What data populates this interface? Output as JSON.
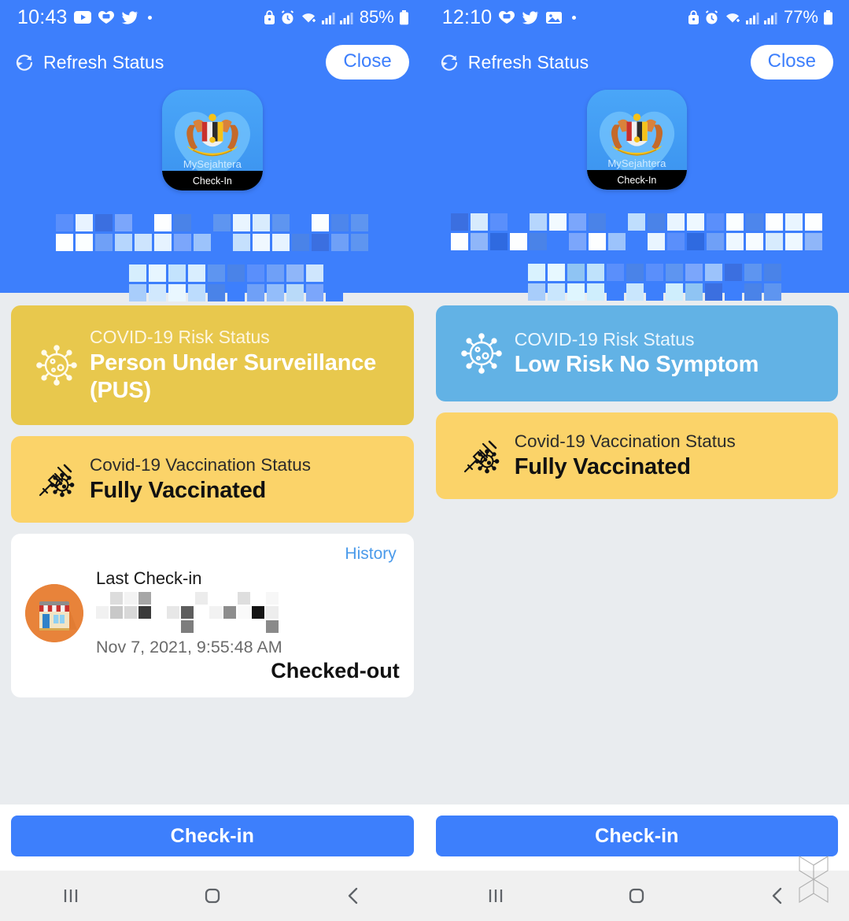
{
  "theme": {
    "header_blue": "#3d7ffc",
    "page_bg": "#e9ecef",
    "risk_yellow": "#e8c84d",
    "risk_blue": "#62b2e5",
    "vaccine_amber": "#fbd369",
    "link_blue": "#4a9aea",
    "shop_orange": "#e8833a"
  },
  "screens": [
    {
      "statusbar": {
        "clock": "10:43",
        "left_icons": [
          "youtube-icon",
          "heart-chat-icon",
          "twitter-icon",
          "more-dot-icon"
        ],
        "right_icons": [
          "lock-icon",
          "alarm-icon",
          "wifi-icon",
          "signal-1-icon",
          "signal-2-icon"
        ],
        "battery": "85%",
        "battery_icon": "battery-icon"
      },
      "header": {
        "refresh_label": "Refresh Status",
        "refresh_icon": "refresh-icon",
        "close_label": "Close",
        "app_icon": {
          "name": "mysejahtera-app-icon",
          "label": "MySejahtera",
          "banner": "Check-In"
        },
        "user_name_redacted": true
      },
      "risk_card": {
        "icon": "virus-icon",
        "sub_label": "COVID-19 Risk Status",
        "status": "Person Under Surveillance (PUS)",
        "color": "#e8c84d"
      },
      "vaccination_card": {
        "icon": "syringe-virus-icon",
        "sub_label": "Covid-19 Vaccination Status",
        "status": "Fully Vaccinated",
        "color": "#fbd369"
      },
      "checkin_card": {
        "history_label": "History",
        "shop_icon": "storefront-icon",
        "title": "Last Check-in",
        "venue_redacted": true,
        "timestamp": "Nov 7, 2021, 9:55:48 AM",
        "status": "Checked-out"
      },
      "bottom": {
        "checkin_label": "Check-in"
      },
      "navbar": {
        "recents_icon": "recents-icon",
        "home_icon": "home-icon",
        "back_icon": "back-icon"
      }
    },
    {
      "statusbar": {
        "clock": "12:10",
        "left_icons": [
          "heart-chat-icon",
          "twitter-icon",
          "image-icon",
          "more-dot-icon"
        ],
        "right_icons": [
          "lock-icon",
          "alarm-icon",
          "wifi-icon",
          "signal-1-icon",
          "signal-2-icon"
        ],
        "battery": "77%",
        "battery_icon": "battery-icon"
      },
      "header": {
        "refresh_label": "Refresh Status",
        "refresh_icon": "refresh-icon",
        "close_label": "Close",
        "app_icon": {
          "name": "mysejahtera-app-icon",
          "label": "MySejahtera",
          "banner": "Check-In"
        },
        "user_name_redacted": true
      },
      "risk_card": {
        "icon": "virus-icon",
        "sub_label": "COVID-19 Risk Status",
        "status": "Low Risk No Symptom",
        "color": "#62b2e5"
      },
      "vaccination_card": {
        "icon": "syringe-virus-icon",
        "sub_label": "Covid-19 Vaccination Status",
        "status": "Fully Vaccinated",
        "color": "#fbd369"
      },
      "checkin_card": null,
      "bottom": {
        "checkin_label": "Check-in"
      },
      "navbar": {
        "recents_icon": "recents-icon",
        "home_icon": "home-icon",
        "back_icon": "back-icon"
      },
      "watermark": "soyacincau-logo-watermark"
    }
  ]
}
